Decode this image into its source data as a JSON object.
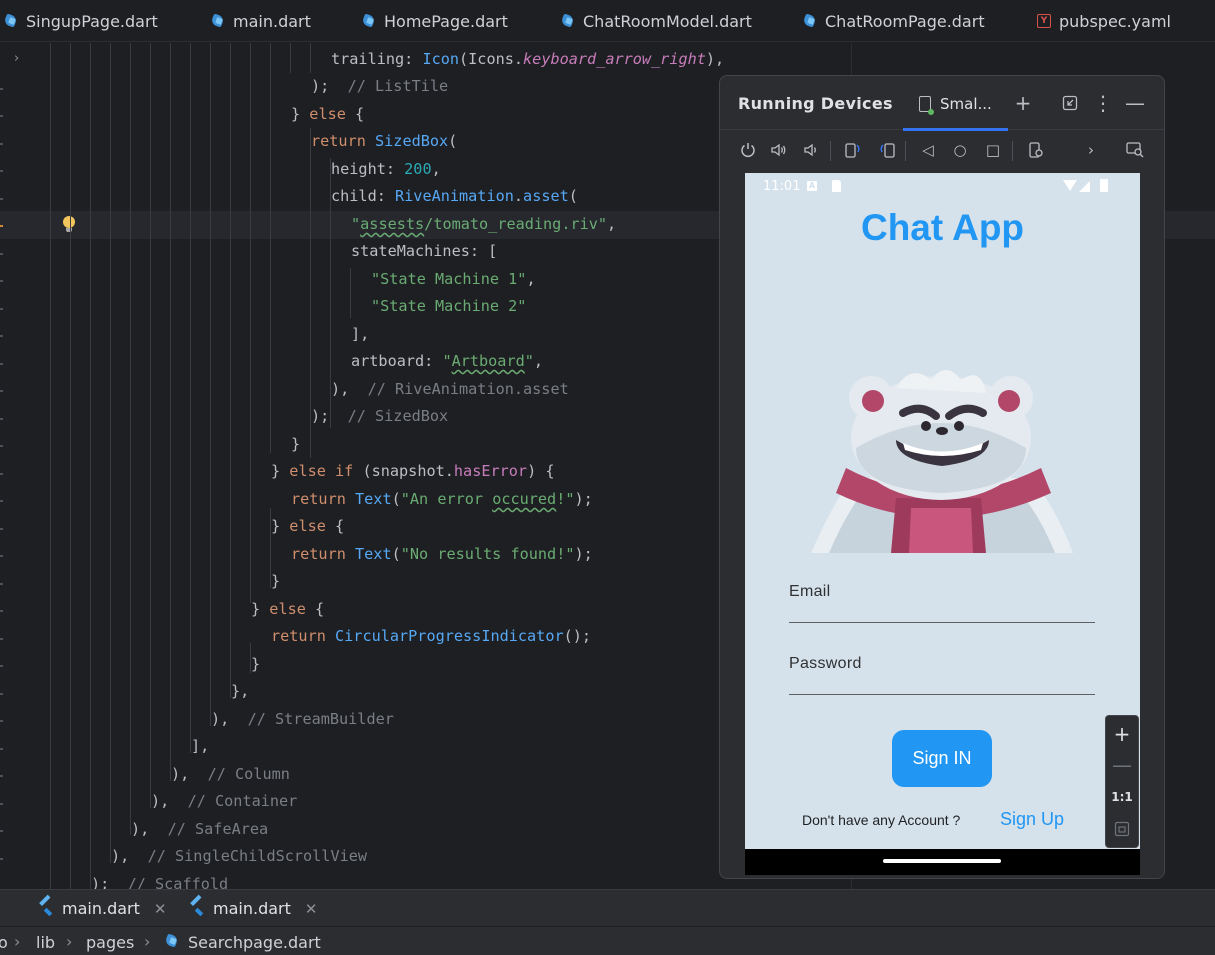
{
  "tabs": [
    {
      "label": "SingupPage.dart",
      "icon": "dart-file-icon"
    },
    {
      "label": "main.dart",
      "icon": "dart-file-icon"
    },
    {
      "label": "HomePage.dart",
      "icon": "dart-file-icon"
    },
    {
      "label": "ChatRoomModel.dart",
      "icon": "dart-file-icon"
    },
    {
      "label": "ChatRoomPage.dart",
      "icon": "dart-file-icon"
    },
    {
      "label": "pubspec.yaml",
      "icon": "yaml-file-icon"
    }
  ],
  "code": {
    "l1": {
      "a": "trailing: ",
      "b": "Icon",
      "c": "(Icons.",
      "d": "keyboard_arrow_right",
      "e": "),"
    },
    "l2": {
      "a": ");  ",
      "b": "// ListTile"
    },
    "l3": {
      "a": "} ",
      "b": "else",
      "c": " {"
    },
    "l4": {
      "a": "return ",
      "b": "SizedBox",
      "c": "("
    },
    "l5": {
      "a": "height: ",
      "b": "200",
      "c": ","
    },
    "l6": {
      "a": "child: ",
      "b": "RiveAnimation",
      "c": ".",
      "d": "asset",
      "e": "("
    },
    "l7": {
      "a": "\"",
      "b": "assests",
      "c": "/tomato_reading.riv\"",
      "d": ","
    },
    "l8": {
      "a": "stateMachines: ["
    },
    "l9": {
      "a": "\"State Machine 1\"",
      "b": ","
    },
    "l10": {
      "a": "\"State Machine 2\""
    },
    "l11": {
      "a": "],"
    },
    "l12": {
      "a": "artboard: ",
      "b": "\"",
      "c": "Artboard",
      "d": "\"",
      "e": ","
    },
    "l13": {
      "a": "),  ",
      "b": "// RiveAnimation.asset"
    },
    "l14": {
      "a": ");  ",
      "b": "// SizedBox"
    },
    "l15": {
      "a": "}"
    },
    "l16": {
      "a": "} ",
      "b": "else if",
      "c": " (snapshot.",
      "d": "hasError",
      "e": ") {"
    },
    "l17": {
      "a": "return ",
      "b": "Text",
      "c": "(",
      "d": "\"An error ",
      "e": "occured",
      "f": "!\"",
      "g": ");"
    },
    "l18": {
      "a": "} ",
      "b": "else",
      "c": " {"
    },
    "l19": {
      "a": "return ",
      "b": "Text",
      "c": "(",
      "d": "\"No results found!\"",
      "e": ");"
    },
    "l20": {
      "a": "}"
    },
    "l21": {
      "a": "} ",
      "b": "else",
      "c": " {"
    },
    "l22": {
      "a": "return ",
      "b": "CircularProgressIndicator",
      "c": "();"
    },
    "l23": {
      "a": "}"
    },
    "l24": {
      "a": "},"
    },
    "l25": {
      "a": "),  ",
      "b": "// StreamBuilder"
    },
    "l26": {
      "a": "],"
    },
    "l27": {
      "a": "),  ",
      "b": "// Column"
    },
    "l28": {
      "a": "),  ",
      "b": "// Container"
    },
    "l29": {
      "a": "),  ",
      "b": "// SafeArea"
    },
    "l30": {
      "a": "),  ",
      "b": "// SingleChildScrollView"
    },
    "l31": {
      "a": ");  ",
      "b": "// Scaffold"
    }
  },
  "running_devices": {
    "title": "Running Devices",
    "device_tab": "Smal..."
  },
  "phone": {
    "status_time": "11:01",
    "status_a": "A",
    "app_title": "Chat App",
    "email_label": "Email",
    "password_label": "Password",
    "signin_label": "Sign IN",
    "no_account_text": "Don't have any Account ?",
    "signup_label": "Sign Up"
  },
  "zoom": {
    "ratio_label": "1:1"
  },
  "bottom_tabs": [
    {
      "label": "main.dart"
    },
    {
      "label": "main.dart"
    }
  ],
  "breadcrumb": [
    "o",
    "lib",
    "pages",
    "Searchpage.dart"
  ],
  "colors": {
    "accent": "#2196f3",
    "phone_bg": "#d6e2eb",
    "editor_bg": "#1e1f22"
  }
}
